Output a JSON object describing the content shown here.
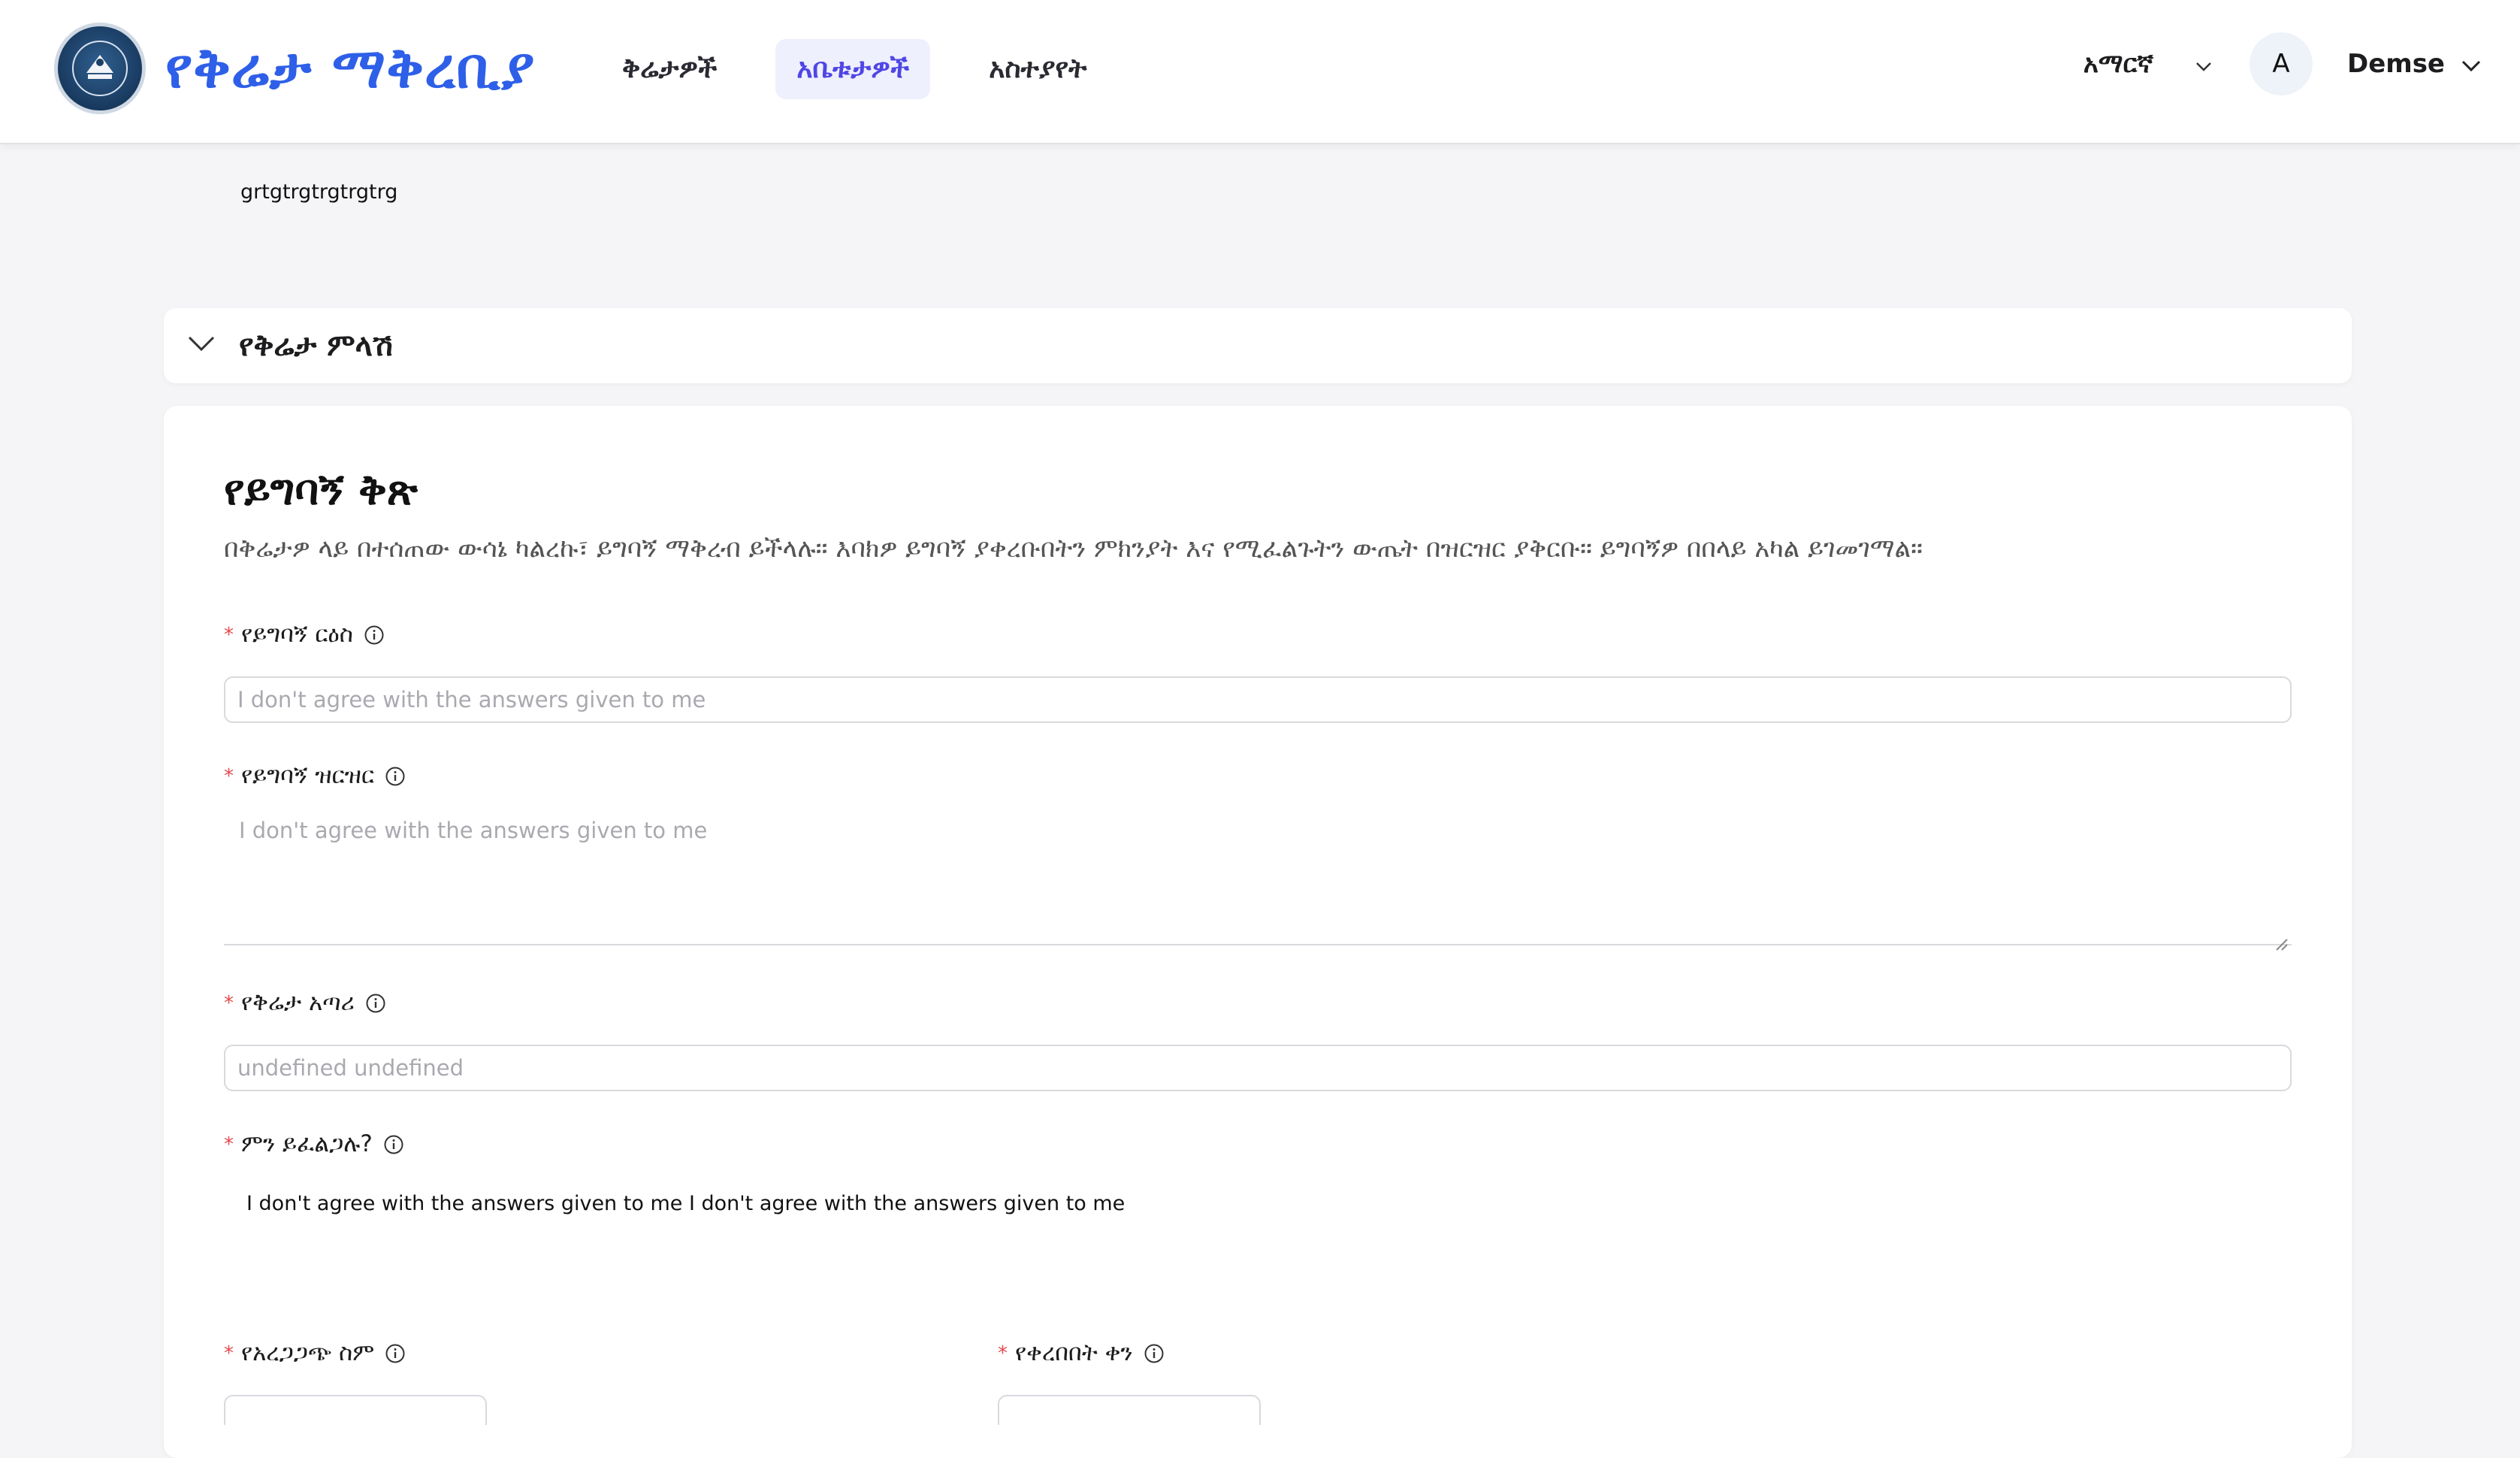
{
  "header": {
    "logo_title": "የቅሬታ ማቅረቢያ",
    "nav": [
      {
        "label": "ቅሬታዎች",
        "active": false
      },
      {
        "label": "አቤቱታዎች",
        "active": true
      },
      {
        "label": "አስተያየት",
        "active": false
      }
    ],
    "language": "አማርኛ",
    "avatar_letter": "A",
    "user_name": "Demse"
  },
  "content": {
    "top_text": "grtgtrgtrgtrgtrg",
    "accordion_title": "የቅሬታ ምላሽ",
    "form": {
      "title": "የይግባኝ ቅጽ",
      "description": "በቅሬታዎ ላይ በተሰጠው ውሳኔ ካልረኩ፣ ይግባኝ ማቅረብ ይችላሉ። እባክዎ ይግባኝ ያቀረቡበትን ምክንያት እና የሚፈልጉትን ውጤት በዝርዝር ያቅርቡ። ይግባኝዎ በበላይ አካል ይገመገማል።",
      "fields": {
        "appeal_title": {
          "label": "የይግባኝ ርዕስ",
          "placeholder": "I don't agree with the answers given to me"
        },
        "appeal_detail": {
          "label": "የይግባኝ ዝርዝር",
          "placeholder": "I don't agree with the answers given to me"
        },
        "complainant": {
          "label": "የቅሬታ አጣሪ",
          "placeholder": "undefined undefined"
        },
        "what_want": {
          "label": "ምን ይፈልጋሉ?",
          "value": "I don't agree with the answers given to me I don't agree with the answers given to me"
        },
        "verifier_name": {
          "label": "የአረጋጋጭ ስም"
        },
        "submitted_date": {
          "label": "የቀረበበት ቀን"
        }
      },
      "required_mark": "*"
    }
  },
  "colors": {
    "brand_blue": "#2e5fe8",
    "active_nav_bg": "#eef0fe",
    "active_nav_text": "#4f46e5",
    "required_red": "#e5484d"
  }
}
